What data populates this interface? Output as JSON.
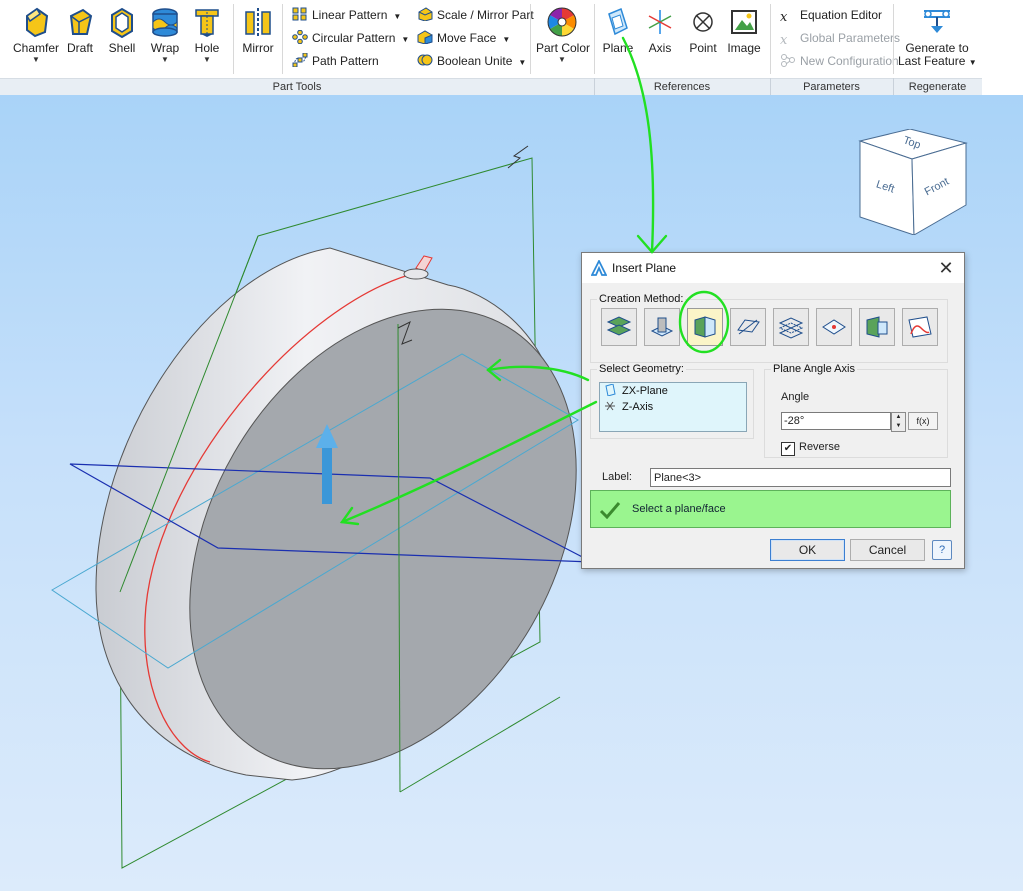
{
  "ribbon": {
    "buttons": {
      "chamfer": "Chamfer",
      "draft": "Draft",
      "shell": "Shell",
      "wrap": "Wrap",
      "hole": "Hole",
      "mirror": "Mirror",
      "part_color": "Part Color",
      "plane": "Plane",
      "axis": "Axis",
      "point": "Point",
      "image": "Image",
      "generate_line1": "Generate to",
      "generate_line2": "Last Feature"
    },
    "small": {
      "linear_pattern": "Linear Pattern",
      "circular_pattern": "Circular Pattern",
      "path_pattern": "Path Pattern",
      "scale_mirror": "Scale / Mirror Part",
      "move_face": "Move Face",
      "boolean_unite": "Boolean Unite",
      "equation_editor": "Equation Editor",
      "global_parameters": "Global Parameters",
      "new_configuration": "New Configuration"
    },
    "groups": {
      "part_tools": "Part Tools",
      "references": "References",
      "parameters": "Parameters",
      "regenerate": "Regenerate"
    }
  },
  "viewcube": {
    "top": "Top",
    "left": "Left",
    "front": "Front"
  },
  "dialog": {
    "title": "Insert Plane",
    "creation_method_label": "Creation Method:",
    "select_geometry_label": "Select Geometry:",
    "geometry_items": [
      "ZX-Plane",
      "Z-Axis"
    ],
    "plane_angle_axis_label": "Plane Angle Axis",
    "angle_label": "Angle",
    "angle_value": "-28°",
    "fx_label": "f(x)",
    "reverse_label": "Reverse",
    "reverse_checked": true,
    "label_label": "Label:",
    "label_value": "Plane<3>",
    "status_text": "Select a plane/face",
    "ok": "OK",
    "cancel": "Cancel",
    "help": "?"
  },
  "colors": {
    "accent_blue": "#2e8ad8",
    "status_green": "#9af58f",
    "annotation_green": "#22e022",
    "selected_method": "#fbf5c8"
  }
}
